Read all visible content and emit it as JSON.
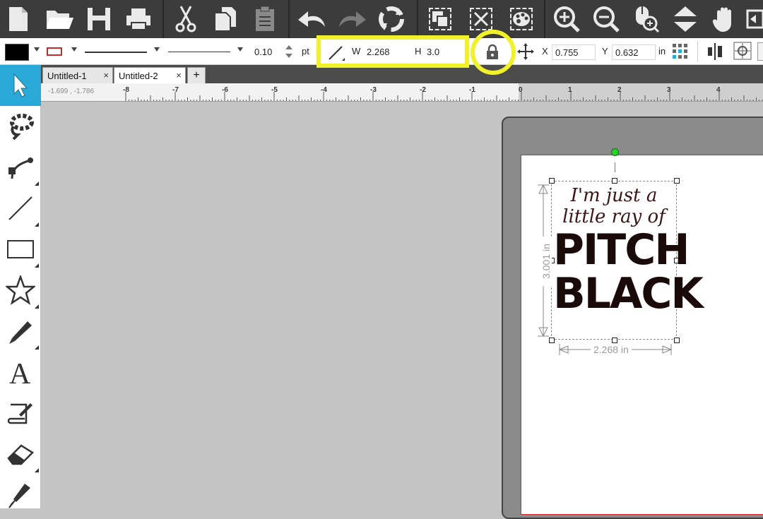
{
  "toolbar": {
    "buttons": [
      "new-document",
      "open",
      "save",
      "print",
      "cut",
      "copy",
      "paste",
      "undo",
      "redo",
      "refresh",
      "group",
      "ungroup",
      "color-palette",
      "zoom-in",
      "zoom-out",
      "zoom-selection",
      "move-down",
      "pan"
    ]
  },
  "propbar": {
    "fill_color": "#000000",
    "stroke_color": "#cc2a2a",
    "stroke_width": "0.10",
    "stroke_unit": "pt",
    "w_label": "W",
    "w_value": "2.268",
    "h_label": "H",
    "h_value": "3.0",
    "x_label": "X",
    "x_value": "0.755",
    "y_label": "Y",
    "y_value": "0.632",
    "pos_unit": "in"
  },
  "tabs": [
    {
      "label": "Untitled-1",
      "close": "×"
    },
    {
      "label": "Untitled-2",
      "close": "×"
    }
  ],
  "new_tab": "+",
  "ruler": {
    "readout": "-1.699 , -1.786",
    "ticks": [
      "-8",
      "-7",
      "-6",
      "-5",
      "-4",
      "-3",
      "-2",
      "-1",
      "0",
      "1",
      "2",
      "3",
      "4"
    ]
  },
  "design": {
    "line1": "I'm just a",
    "line2": "little ray of",
    "line3": "PITCH",
    "line4": "BLACK",
    "height_label": "3.001 in",
    "width_label": "2.268 in"
  },
  "colors": {
    "toolbar_bg": "#3c3c3c",
    "selected_tool": "#29a9d8",
    "highlight": "#f1f12a",
    "canvas_bg": "#c4c4c4"
  }
}
